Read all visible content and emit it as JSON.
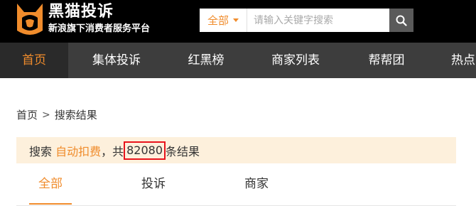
{
  "brand": {
    "title": "黑猫投诉",
    "subtitle": "新浪旗下消费者服务平台",
    "logo_icon": "black-cat-logo-icon",
    "logo_color": "#f08c2c"
  },
  "search": {
    "category": "全部",
    "placeholder": "请输入关键字搜索",
    "value": "",
    "button_icon": "search-icon"
  },
  "nav": {
    "items": [
      {
        "label": "首页",
        "active": true
      },
      {
        "label": "集体投诉",
        "active": false
      },
      {
        "label": "红黑榜",
        "active": false
      },
      {
        "label": "商家列表",
        "active": false
      },
      {
        "label": "帮帮团",
        "active": false
      },
      {
        "label": "热点",
        "active": false
      }
    ]
  },
  "breadcrumb": {
    "home": "首页",
    "separator": ">",
    "current": "搜索结果"
  },
  "result": {
    "prefix": "搜索 ",
    "keyword": "自动扣费",
    "middle": "，共",
    "count": "82080",
    "suffix": "条结果"
  },
  "tabs": [
    {
      "label": "全部",
      "active": true
    },
    {
      "label": "投诉",
      "active": false
    },
    {
      "label": "商家",
      "active": false
    }
  ],
  "colors": {
    "accent": "#f08c2c",
    "header_bg": "#000000",
    "nav_bg": "#3d3d3d",
    "banner_bg": "#fdf0dc",
    "highlight_box": "#e8141c"
  }
}
